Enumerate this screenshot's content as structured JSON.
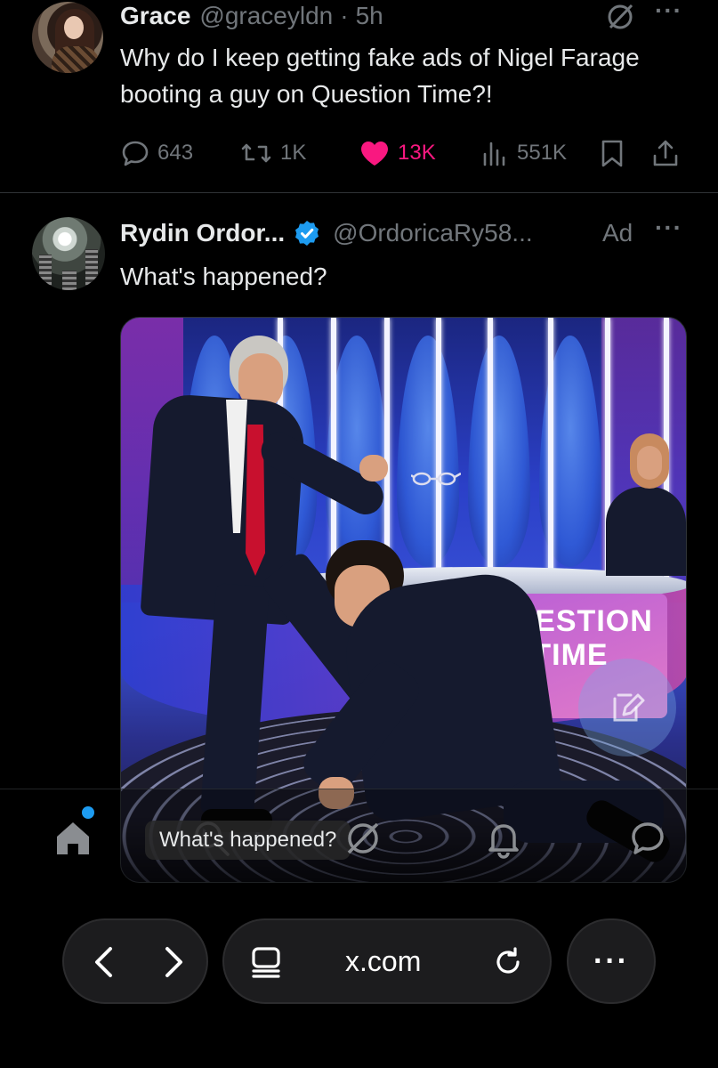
{
  "tweet1": {
    "name": "Grace",
    "handle": "@graceyldn",
    "separator": "·",
    "time": "5h",
    "text": "Why do I keep getting fake ads of Nigel Farage booting a guy on Question Time?!",
    "stats": {
      "replies": "643",
      "reposts": "1K",
      "likes": "13K",
      "views": "551K"
    },
    "liked": true
  },
  "tweet2": {
    "name": "Rydin Ordor...",
    "verified": true,
    "handle": "@OrdoricaRy58...",
    "ad_label": "Ad",
    "text": "What's happened?",
    "media": {
      "logo_text_line1": "QUESTION",
      "logo_text_line2": "TIME"
    }
  },
  "more_label": "···",
  "bottom_nav": {
    "search_text": "What's happened?",
    "items": [
      "home-icon",
      "search-icon",
      "grok-icon",
      "notifications-icon",
      "messages-icon"
    ],
    "home_badge": true
  },
  "browser": {
    "url": "x.com",
    "more": "···"
  },
  "colors": {
    "background": "#000000",
    "text": "#e7e9ea",
    "secondary": "#71767b",
    "like": "#f91880",
    "verified": "#1d9bf0"
  }
}
